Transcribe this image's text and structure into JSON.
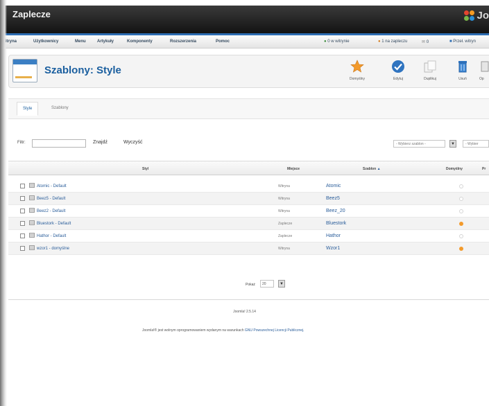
{
  "header": {
    "site_title": "Zaplecze",
    "brand_text": "Jo"
  },
  "menu": {
    "items": [
      "Witryna",
      "Użytkownicy",
      "Menu",
      "Artykuły",
      "Komponenty",
      "Rozszerzenia",
      "Pomoc"
    ],
    "status": {
      "site_visitors": "0 w witrynie",
      "admins": "1 na zapleczu",
      "messages": "0",
      "preview": "Przeł. witryn"
    }
  },
  "toolbar": {
    "page_title": "Szablony: Style",
    "buttons": [
      {
        "label": "Domyślny",
        "icon": "star-icon"
      },
      {
        "label": "Edytuj",
        "icon": "edit-icon"
      },
      {
        "label": "Duplikuj",
        "icon": "copy-icon"
      },
      {
        "label": "Usuń",
        "icon": "trash-icon"
      },
      {
        "label": "Op",
        "icon": "options-icon"
      }
    ]
  },
  "tabs": [
    {
      "label": "Style",
      "active": true
    },
    {
      "label": "Szablony",
      "active": false
    }
  ],
  "filter": {
    "label": "Filtr:",
    "search_value": "",
    "search_button": "Znajdź",
    "clear_button": "Wyczyść",
    "template_select": "- Wybierz szablon -",
    "location_select": "- Wybier"
  },
  "table": {
    "headers": {
      "style": "Styl",
      "location": "Miejsce",
      "template": "Szablon",
      "default": "Domyślny",
      "extra": "Pr"
    },
    "rows": [
      {
        "style": "Atomic - Default",
        "location": "Witryna",
        "template": "Atomic",
        "default": false
      },
      {
        "style": "Beez5 - Default",
        "location": "Witryna",
        "template": "Beez5",
        "default": false
      },
      {
        "style": "Beez2 - Default",
        "location": "Witryna",
        "template": "Beez_20",
        "default": false
      },
      {
        "style": "Bluestork - Default",
        "location": "Zaplecze",
        "template": "Bluestork",
        "default": true
      },
      {
        "style": "Hathor - Default",
        "location": "Zaplecze",
        "template": "Hathor",
        "default": false
      },
      {
        "style": "wzor1 - domyślne",
        "location": "Witryna",
        "template": "Wzor1",
        "default": true
      }
    ]
  },
  "pagination": {
    "label": "Pokaż",
    "value": "20"
  },
  "footer": {
    "version": "Joomla! 2.5.14",
    "license_prefix": "Joomla!® jest wolnym oprogramowaniem wydanym na warunkach",
    "license_link": "GNU Powszechnej Licencji Publicznej."
  },
  "colors": {
    "header": "#1a1a1a",
    "accent": "#2d6db2",
    "title": "#1b5f9f",
    "default_star": "#f39a2b"
  }
}
